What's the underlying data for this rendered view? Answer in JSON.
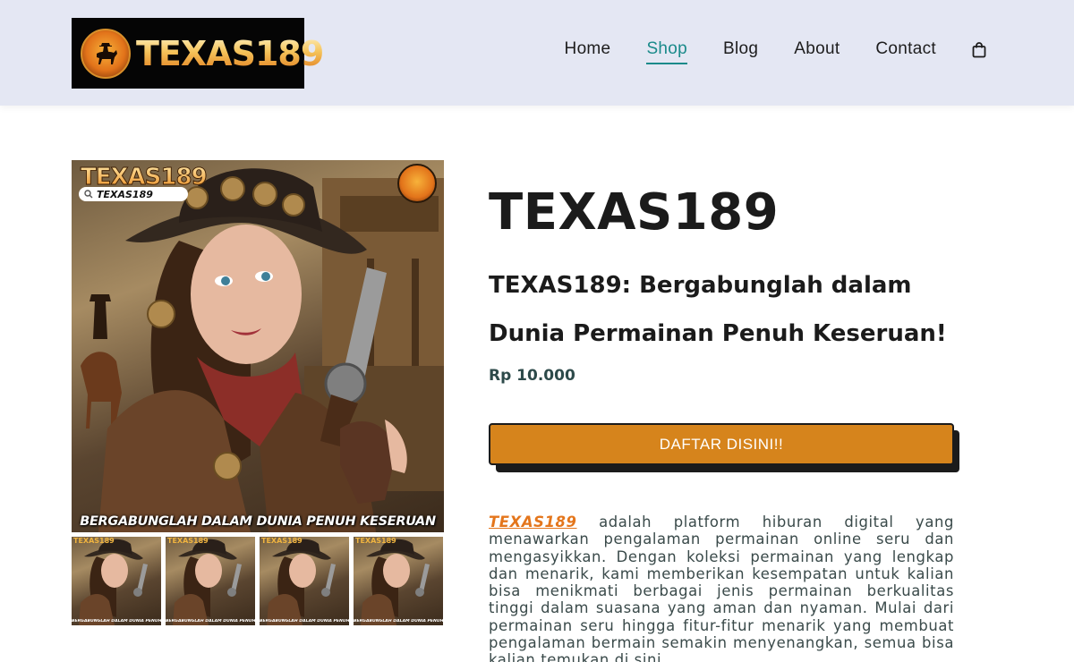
{
  "header": {
    "logo_text": "TEXAS189",
    "nav": [
      {
        "label": "Home",
        "active": false
      },
      {
        "label": "Shop",
        "active": true
      },
      {
        "label": "Blog",
        "active": false
      },
      {
        "label": "About",
        "active": false
      },
      {
        "label": "Contact",
        "active": false
      }
    ],
    "cart_icon": "shopping-bag-icon",
    "active_color": "#1a8a8a",
    "background": "#e4e7f3"
  },
  "gallery": {
    "main": {
      "brand": "TEXAS189",
      "search_text": "TEXAS189",
      "caption": "BERGABUNGLAH DALAM DUNIA PENUH KESERUAN"
    },
    "thumbnails": [
      {
        "brand": "TEXAS189",
        "caption": "BERGABUNGLAH DALAM DUNIA PENUH KESERUAN"
      },
      {
        "brand": "TEXAS189",
        "caption": "BERGABUNGLAH DALAM DUNIA PENUH KESERUAN"
      },
      {
        "brand": "TEXAS189",
        "caption": "BERGABUNGLAH DALAM DUNIA PENUH KESERUAN"
      },
      {
        "brand": "TEXAS189",
        "caption": "BERGABUNGLAH DALAM DUNIA PENUH KESERUAN"
      }
    ]
  },
  "product": {
    "title": "TEXAS189",
    "subtitle": "TEXAS189: Bergabunglah dalam Dunia Permainan Penuh Keseruan!",
    "price": "Rp 10.000",
    "cta_label": "DAFTAR DISINI!!",
    "cta_color": "#d6841c",
    "description_link": "TEXAS189",
    "description_rest": " adalah platform hiburan digital yang menawarkan pengalaman permainan online seru dan mengasyikkan. Dengan koleksi permainan yang lengkap dan menarik, kami memberikan kesempatan untuk kalian bisa menikmati berbagai jenis permainan berkualitas tinggi dalam suasana yang aman dan nyaman. Mulai dari permainan seru hingga fitur-fitur menarik yang membuat pengalaman bermain semakin menyenangkan, semua bisa kalian temukan di sini."
  }
}
